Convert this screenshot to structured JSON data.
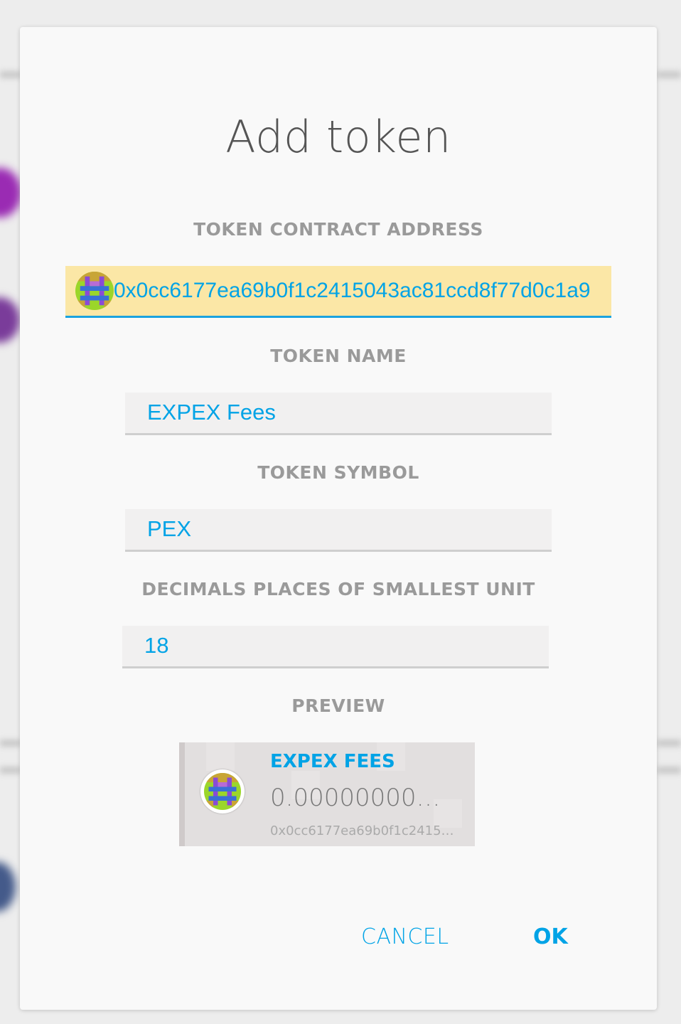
{
  "dialog": {
    "title": "Add token"
  },
  "fields": {
    "address": {
      "label": "TOKEN CONTRACT ADDRESS",
      "value": "0x0cc6177ea69b0f1c2415043ac81ccd8f77d0c1a9"
    },
    "name": {
      "label": "TOKEN NAME",
      "value": "EXPEX Fees"
    },
    "symbol": {
      "label": "TOKEN SYMBOL",
      "value": "PEX"
    },
    "decimals": {
      "label": "DECIMALS PLACES OF SMALLEST UNIT",
      "value": "18"
    }
  },
  "preview": {
    "label": "PREVIEW",
    "token_name": "EXPEX FEES",
    "balance": "0.000000000000000000",
    "address": "0x0cc6177ea69b0f1c2415043ac81ccd8f77d0c1a9",
    "icon": "token-identicon"
  },
  "buttons": {
    "cancel": "CANCEL",
    "ok": "OK"
  },
  "colors": {
    "accent": "#00a3e6",
    "address_highlight": "#fbe7a6",
    "label_gray": "#9a9a9a"
  }
}
